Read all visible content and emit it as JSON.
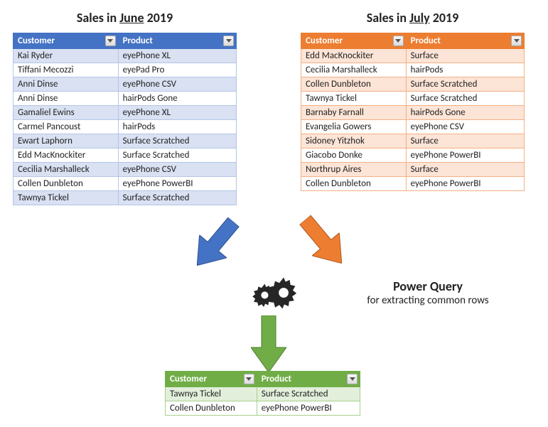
{
  "titles": {
    "june_prefix": "Sales in ",
    "june_month": "June",
    "june_suffix": " 2019",
    "july_prefix": "Sales in ",
    "july_month": "July",
    "july_suffix": " 2019"
  },
  "headers": {
    "customer": "Customer",
    "product": "Product"
  },
  "june": {
    "rows": [
      {
        "c": "Kai Ryder",
        "p": "eyePhone XL"
      },
      {
        "c": "Tiffani Mecozzi",
        "p": "eyePad Pro"
      },
      {
        "c": "Anni Dinse",
        "p": "eyePhone CSV"
      },
      {
        "c": "Anni Dinse",
        "p": "hairPods Gone"
      },
      {
        "c": "Gamaliel Ewins",
        "p": "eyePhone XL"
      },
      {
        "c": "Carmel Pancoust",
        "p": "hairPods"
      },
      {
        "c": "Ewart Laphorn",
        "p": "Surface Scratched"
      },
      {
        "c": "Edd MacKnockiter",
        "p": "Surface Scratched"
      },
      {
        "c": "Cecilia Marshalleck",
        "p": "eyePhone CSV"
      },
      {
        "c": "Collen Dunbleton",
        "p": "eyePhone PowerBI"
      },
      {
        "c": "Tawnya Tickel",
        "p": "Surface Scratched"
      }
    ]
  },
  "july": {
    "rows": [
      {
        "c": "Edd MacKnockiter",
        "p": "Surface"
      },
      {
        "c": "Cecilia Marshalleck",
        "p": "hairPods"
      },
      {
        "c": "Collen Dunbleton",
        "p": "Surface Scratched"
      },
      {
        "c": "Tawnya Tickel",
        "p": "Surface Scratched"
      },
      {
        "c": "Barnaby Farnall",
        "p": "hairPods Gone"
      },
      {
        "c": "Evangelia Gowers",
        "p": "eyePhone CSV"
      },
      {
        "c": "Sidoney Yitzhok",
        "p": "Surface"
      },
      {
        "c": "Giacobo Donke",
        "p": "eyePhone PowerBI"
      },
      {
        "c": "Northrup Aires",
        "p": "Surface"
      },
      {
        "c": "Collen Dunbleton",
        "p": "eyePhone PowerBI"
      }
    ]
  },
  "result": {
    "rows": [
      {
        "c": "Tawnya Tickel",
        "p": "Surface Scratched"
      },
      {
        "c": "Collen Dunbleton",
        "p": "eyePhone PowerBI"
      }
    ]
  },
  "powerquery": {
    "title": "Power Query",
    "subtitle": "for extracting common rows"
  },
  "colors": {
    "blue": "#4472C4",
    "orange": "#ED7D31",
    "green": "#70AD47",
    "gears": "#262626"
  }
}
